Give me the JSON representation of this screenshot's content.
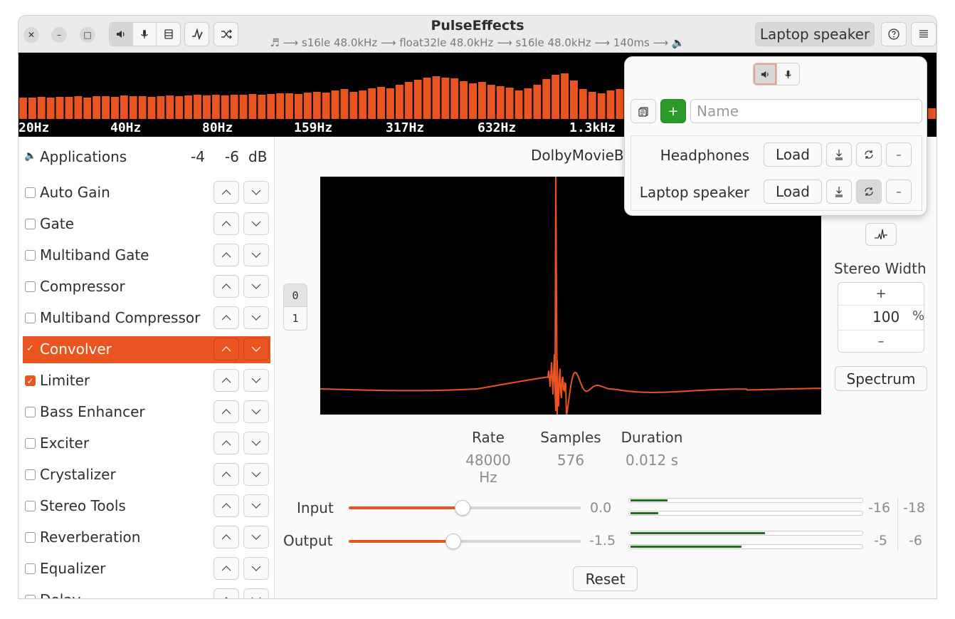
{
  "window": {
    "title": "PulseEffects",
    "subtitle": "♬ ⟶ s16le 48.0kHz ⟶ float32le 48.0kHz ⟶ s16le 48.0kHz ⟶ 140ms ⟶ 🔈",
    "controls": {
      "close": "✕",
      "minimize": "–",
      "maximize": "□"
    },
    "mode_icons": [
      "speaker-icon",
      "microphone-icon",
      "list-icon"
    ],
    "mode_selected": "speaker-icon",
    "preset_button_label": "Laptop speaker"
  },
  "spectrum": {
    "bar_color": "#e95420",
    "bars": [
      30,
      30,
      31,
      30,
      31,
      31,
      32,
      30,
      32,
      32,
      31,
      33,
      32,
      32,
      31,
      32,
      33,
      32,
      33,
      34,
      33,
      34,
      33,
      34,
      34,
      35,
      34,
      35,
      36,
      36,
      35,
      37,
      38,
      37,
      40,
      42,
      38,
      40,
      43,
      45,
      43,
      48,
      52,
      55,
      58,
      60,
      58,
      57,
      53,
      50,
      52,
      48,
      46,
      44,
      40,
      43,
      48,
      56,
      62,
      64,
      54,
      42,
      38,
      36,
      40,
      42,
      38,
      37,
      36,
      35,
      38,
      42,
      40,
      38,
      36,
      35,
      33,
      34,
      32,
      33,
      32,
      31,
      30,
      28,
      26,
      25,
      24,
      23,
      22,
      21,
      20,
      20,
      19,
      19,
      18,
      18,
      17,
      17,
      16,
      15
    ],
    "freq_labels": [
      "20Hz",
      "40Hz",
      "80Hz",
      "159Hz",
      "317Hz",
      "632Hz",
      "1.3kHz"
    ]
  },
  "applications": {
    "label": "Applications",
    "values": [
      "-4",
      "-6",
      "dB"
    ]
  },
  "plugins": [
    {
      "name": "Auto Gain",
      "checked": false
    },
    {
      "name": "Gate",
      "checked": false
    },
    {
      "name": "Multiband Gate",
      "checked": false
    },
    {
      "name": "Compressor",
      "checked": false
    },
    {
      "name": "Multiband Compressor",
      "checked": false
    },
    {
      "name": "Convolver",
      "checked": true,
      "selected": true
    },
    {
      "name": "Limiter",
      "checked": true
    },
    {
      "name": "Bass Enhancer",
      "checked": false
    },
    {
      "name": "Exciter",
      "checked": false
    },
    {
      "name": "Crystalizer",
      "checked": false
    },
    {
      "name": "Stereo Tools",
      "checked": false
    },
    {
      "name": "Reverberation",
      "checked": false
    },
    {
      "name": "Equalizer",
      "checked": false
    },
    {
      "name": "Delay",
      "checked": false
    }
  ],
  "convolver": {
    "irs_name": "DolbyMovieB",
    "channels": [
      "0",
      "1"
    ],
    "stats": [
      {
        "key": "Rate",
        "value": "48000 Hz"
      },
      {
        "key": "Samples",
        "value": "576"
      },
      {
        "key": "Duration",
        "value": "0.012 s"
      }
    ],
    "stereo_width_label": "Stereo Width",
    "stereo_width": {
      "plus": "+",
      "value": "100",
      "unit": "%",
      "minus": "–"
    },
    "spectrum_button": "Spectrum",
    "waveform_color": "#e95420"
  },
  "io": {
    "input_label": "Input",
    "input_value": "0.0",
    "input_fraction": 0.49,
    "output_label": "Output",
    "output_value": "-1.5",
    "output_fraction": 0.45,
    "input_peaks": [
      "-16",
      "-18"
    ],
    "output_peaks": [
      "-5",
      "-6"
    ],
    "input_meter_levels": [
      0.16,
      0.12
    ],
    "output_meter_levels": [
      0.58,
      0.48
    ],
    "reset_label": "Reset"
  },
  "presets_popover": {
    "name_placeholder": "Name",
    "add_icon": "+",
    "load_label": "Load",
    "presets": [
      {
        "name": "Headphones",
        "autoload_active": false
      },
      {
        "name": "Laptop speaker",
        "autoload_active": true
      }
    ]
  }
}
